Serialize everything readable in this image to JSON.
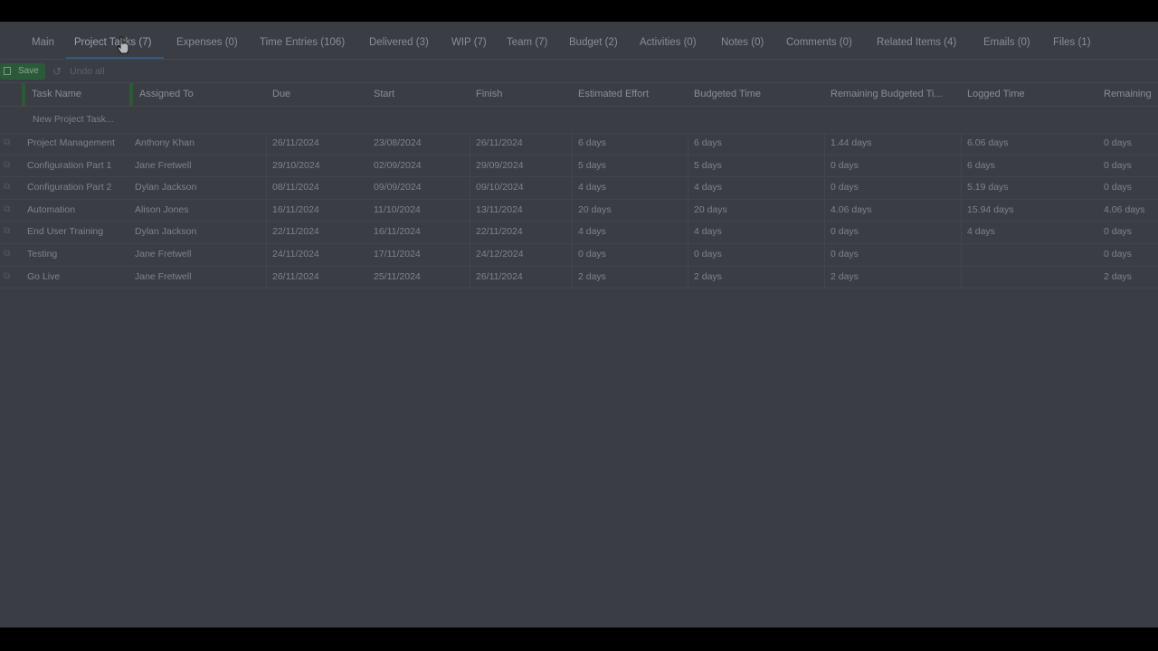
{
  "tabs": [
    {
      "label": "Main"
    },
    {
      "label": "Project Tasks (7)"
    },
    {
      "label": "Expenses (0)"
    },
    {
      "label": "Time Entries (106)"
    },
    {
      "label": "Delivered (3)"
    },
    {
      "label": "WIP (7)"
    },
    {
      "label": "Team (7)"
    },
    {
      "label": "Budget (2)"
    },
    {
      "label": "Activities (0)"
    },
    {
      "label": "Notes (0)"
    },
    {
      "label": "Comments (0)"
    },
    {
      "label": "Related Items (4)"
    },
    {
      "label": "Emails (0)"
    },
    {
      "label": "Files (1)"
    }
  ],
  "toolbar": {
    "save_label": "Save",
    "undo_label": "Undo all"
  },
  "columns": [
    "Task Name",
    "Assigned To",
    "Due",
    "Start",
    "Finish",
    "Estimated Effort",
    "Budgeted Time",
    "Remaining Budgeted Ti...",
    "Logged Time",
    "Remaining"
  ],
  "new_task_label": "New Project Task...",
  "rows": [
    [
      "Project Management",
      "Anthony Khan",
      "26/11/2024",
      "23/08/2024",
      "26/11/2024",
      "6 days",
      "6 days",
      "1.44 days",
      "6.06 days",
      "0 days"
    ],
    [
      "Configuration Part 1",
      "Jane Fretwell",
      "29/10/2024",
      "02/09/2024",
      "29/09/2024",
      "5 days",
      "5 days",
      "0 days",
      "6 days",
      "0 days"
    ],
    [
      "Configuration Part 2",
      "Dylan Jackson",
      "08/11/2024",
      "09/09/2024",
      "09/10/2024",
      "4 days",
      "4 days",
      "0 days",
      "5.19 days",
      "0 days"
    ],
    [
      "Automation",
      "Alison Jones",
      "16/11/2024",
      "11/10/2024",
      "13/11/2024",
      "20 days",
      "20 days",
      "4.06 days",
      "15.94 days",
      "4.06 days"
    ],
    [
      "End User Training",
      "Dylan Jackson",
      "22/11/2024",
      "16/11/2024",
      "22/11/2024",
      "4 days",
      "4 days",
      "0 days",
      "4 days",
      "0 days"
    ],
    [
      "Testing",
      "Jane Fretwell",
      "24/11/2024",
      "17/11/2024",
      "24/12/2024",
      "0 days",
      "0 days",
      "0 days",
      "",
      "0 days"
    ],
    [
      "Go Live",
      "Jane Fretwell",
      "26/11/2024",
      "25/11/2024",
      "26/11/2024",
      "2 days",
      "2 days",
      "2 days",
      "",
      "2 days"
    ]
  ],
  "colors": {
    "overlay_background": "#3a3e44",
    "save_green": "#2b5a3a",
    "active_tab_underline": "#2e5a83",
    "column_marker": "#2c5a35"
  }
}
